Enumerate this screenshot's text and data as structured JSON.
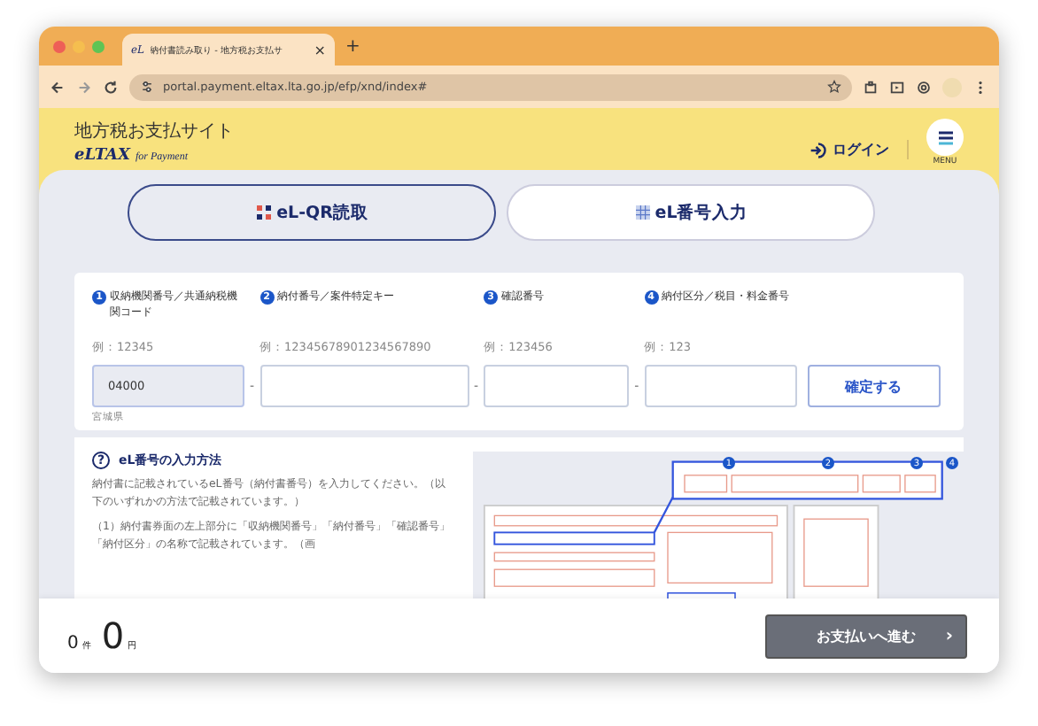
{
  "browser": {
    "tab": {
      "favicon": "eL",
      "title": "納付書読み取り - 地方税お支払サ",
      "close": "×"
    },
    "new_tab": "+",
    "address": "portal.payment.eltax.lta.go.jp/efp/xnd/index#"
  },
  "header": {
    "site_title": "地方税お支払サイト",
    "logo_main": "eLTAX",
    "logo_sub": "for Payment",
    "login": "ログイン",
    "menu_label": "MENU"
  },
  "mode_tabs": [
    {
      "label": "eL-QR読取",
      "kind": "qr",
      "selected": false
    },
    {
      "label": "eL番号入力",
      "kind": "grid",
      "selected": true
    }
  ],
  "fields": [
    {
      "step": "1",
      "label": "収納機関番号／共通納税機関コード",
      "example": "例：12345",
      "value": "04000",
      "note": "宮城県",
      "filled": true
    },
    {
      "step": "2",
      "label": "納付番号／案件特定キー",
      "example": "例：12345678901234567890",
      "filled": false
    },
    {
      "step": "3",
      "label": "確認番号",
      "example": "例：123456",
      "filled": false
    },
    {
      "step": "4",
      "label": "納付区分／税目・料金番号",
      "example": "例：123",
      "filled": false
    }
  ],
  "separator": "-",
  "confirm_button": "確定する",
  "help": {
    "icon": "?",
    "title": "eL番号の入力方法",
    "paragraphs": [
      "納付書に記載されているeL番号（納付書番号）を入力してください。（以下のいずれかの方法で記載されています。）",
      "（1）納付書券面の左上部分に「収納機関番号」「納付番号」「確認番号」「納付区分」の名称で記載されています。（画"
    ]
  },
  "slip_markers": [
    "1",
    "2",
    "3",
    "4"
  ],
  "footer": {
    "count": "0",
    "count_unit": "件",
    "amount": "0",
    "amount_unit": "円",
    "proceed": "お支払いへ進む",
    "chevron": "›"
  }
}
